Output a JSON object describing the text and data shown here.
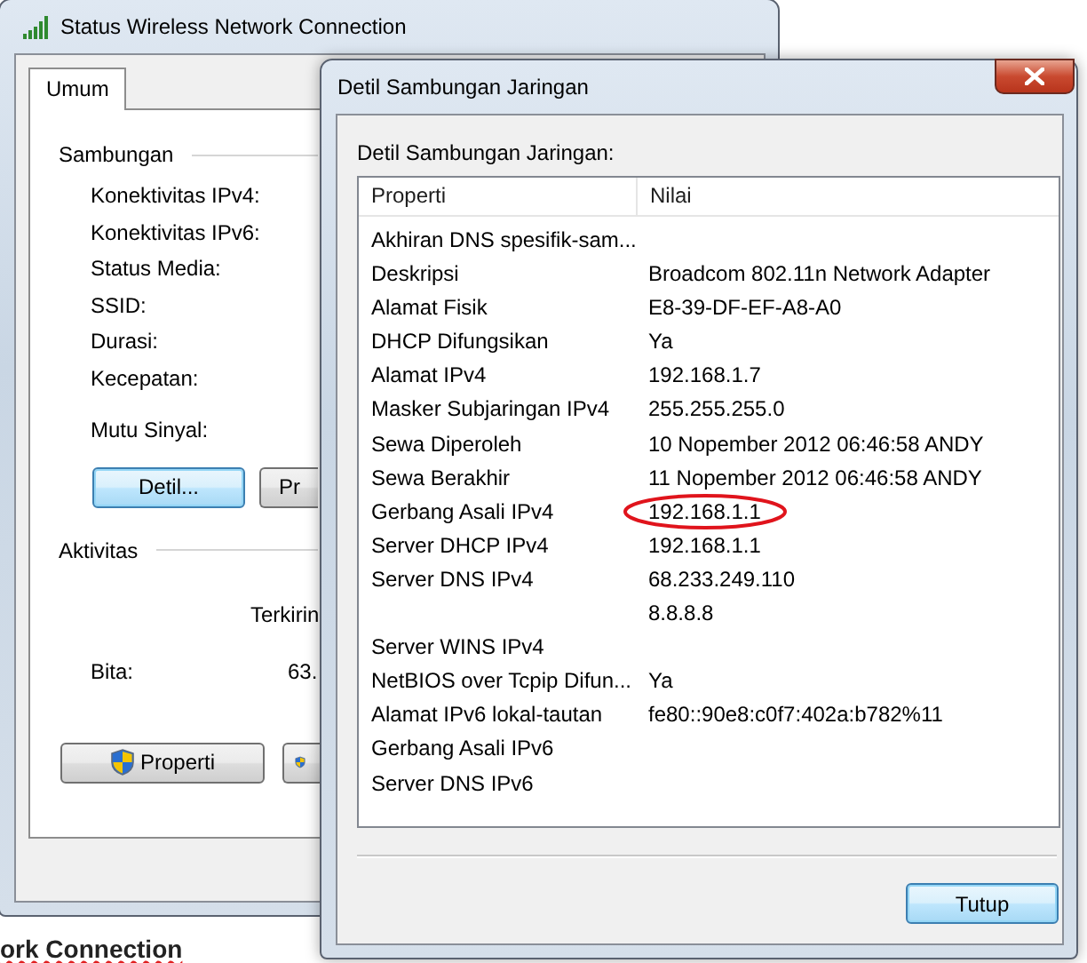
{
  "status_window": {
    "title": "Status Wireless Network Connection",
    "tabs": [
      {
        "label": "Umum",
        "selected": true
      }
    ],
    "connection_group": {
      "title": "Sambungan",
      "fields": [
        "Konektivitas IPv4:",
        "Konektivitas IPv6:",
        "Status Media:",
        "SSID:",
        "Durasi:",
        "Kecepatan:"
      ],
      "signal_label": "Mutu Sinyal:"
    },
    "buttons": [
      {
        "label": "Detil...",
        "focused": true
      },
      {
        "label": "Pr",
        "focused": false
      }
    ],
    "activity_group": {
      "title": "Aktivitas",
      "column_heading": "Terkirin",
      "fields": [
        {
          "label": "Bita:",
          "value": "63."
        }
      ]
    },
    "bottom_buttons": [
      {
        "label": "Properti",
        "shield": true
      },
      {
        "shield": true
      }
    ]
  },
  "details_dialog": {
    "title": "Detil Sambungan Jaringan",
    "heading": "Detil Sambungan Jaringan:",
    "table": {
      "columns": [
        "Properti",
        "Nilai"
      ],
      "rows": [
        {
          "property": "Akhiran DNS spesifik-sam...",
          "circled": false
        },
        {
          "property": "Deskripsi",
          "value": "Broadcom 802.11n Network Adapter",
          "circled": false
        },
        {
          "property": "Alamat Fisik",
          "value": "E8-39-DF-EF-A8-A0",
          "circled": false
        },
        {
          "property": "DHCP Difungsikan",
          "value": "Ya",
          "circled": false
        },
        {
          "property": "Alamat IPv4",
          "value": "192.168.1.7",
          "circled": false
        },
        {
          "property": "Masker Subjaringan IPv4",
          "value": "255.255.255.0",
          "circled": false
        },
        {
          "property": "Sewa Diperoleh",
          "value": "10 Nopember 2012 06:46:58 ANDY",
          "circled": false
        },
        {
          "property": "Sewa Berakhir",
          "value": "11 Nopember 2012 06:46:58 ANDY",
          "circled": false
        },
        {
          "property": "Gerbang Asali IPv4",
          "value": "192.168.1.1",
          "circled": true
        },
        {
          "property": "Server DHCP IPv4",
          "value": "192.168.1.1",
          "circled": false
        },
        {
          "property": "Server DNS IPv4",
          "value": "68.233.249.110",
          "circled": false
        },
        {
          "value": "8.8.8.8",
          "circled": false
        },
        {
          "property": "Server WINS IPv4",
          "circled": false
        },
        {
          "property": "NetBIOS over Tcpip Difun...",
          "value": "Ya",
          "circled": false
        },
        {
          "property": "Alamat IPv6 lokal-tautan",
          "value": "fe80::90e8:c0f7:402a:b782%11",
          "circled": false
        },
        {
          "property": "Gerbang Asali IPv6",
          "circled": false
        },
        {
          "property": "Server DNS IPv6",
          "circled": false
        }
      ]
    },
    "buttons": [
      {
        "label": "Tutup",
        "focused": true
      }
    ]
  },
  "background_text": "ork Connection"
}
